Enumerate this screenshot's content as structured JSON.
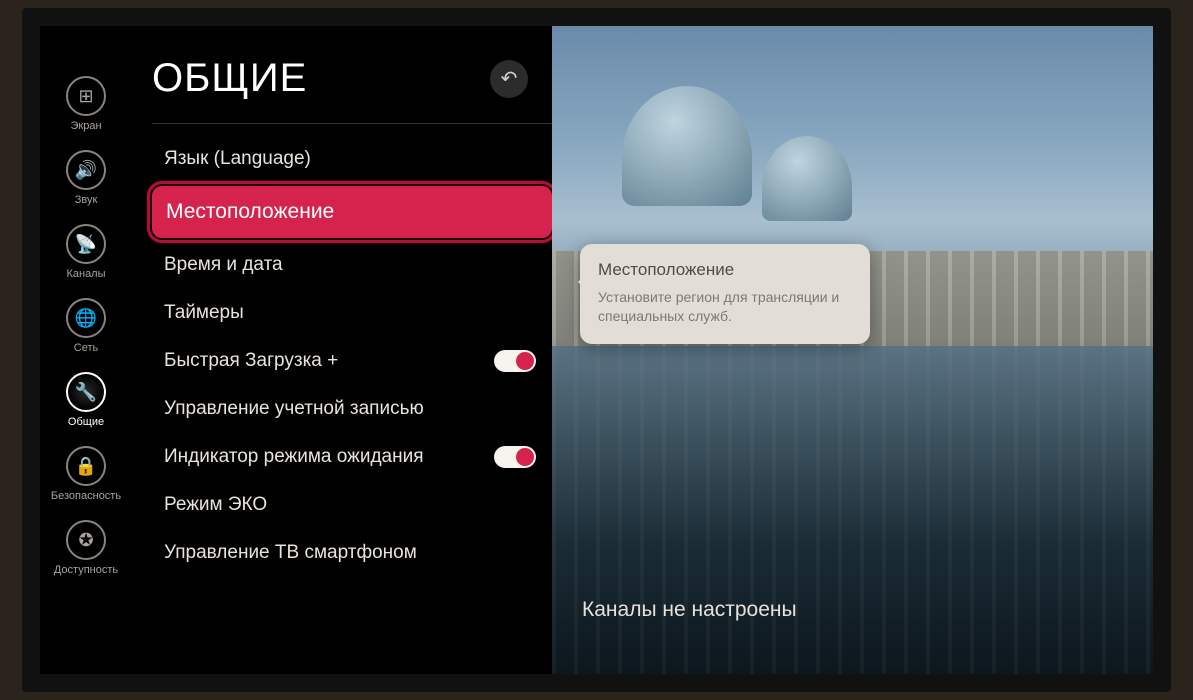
{
  "rail": [
    {
      "label": "Экран",
      "icon": "⊞"
    },
    {
      "label": "Звук",
      "icon": "🔊"
    },
    {
      "label": "Каналы",
      "icon": "📡"
    },
    {
      "label": "Сеть",
      "icon": "🌐"
    },
    {
      "label": "Общие",
      "icon": "🔧",
      "active": true
    },
    {
      "label": "Безопасность",
      "icon": "🔒"
    },
    {
      "label": "Доступность",
      "icon": "✪"
    }
  ],
  "panel": {
    "title": "ОБЩИЕ",
    "items": [
      {
        "label": "Язык (Language)"
      },
      {
        "label": "Местоположение",
        "selected": true
      },
      {
        "label": "Время и дата"
      },
      {
        "label": "Таймеры"
      },
      {
        "label": "Быстрая Загрузка +",
        "toggle": "on"
      },
      {
        "label": "Управление учетной записью"
      },
      {
        "label": "Индикатор режима ожидания",
        "toggle": "on"
      },
      {
        "label": "Режим ЭКО"
      },
      {
        "label": "Управление ТВ смартфоном"
      }
    ]
  },
  "tooltip": {
    "title": "Местоположение",
    "text": "Установите регион для трансляции и специальных служб."
  },
  "status": "Каналы не настроены"
}
